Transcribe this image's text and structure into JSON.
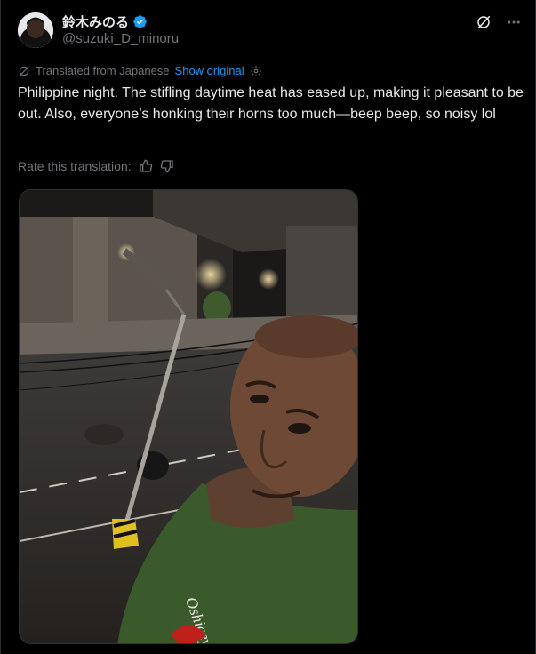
{
  "author": {
    "display_name": "鈴木みのる",
    "handle": "@suzuki_D_minoru"
  },
  "translation": {
    "label": "Translated from Japanese",
    "show_original": "Show original"
  },
  "post": {
    "text": "Philippine night. The stifling daytime heat has eased up, making it pleasant to be out. Also, everyone’s honking their horns too much—beep beep, so noisy lol"
  },
  "rate": {
    "label": "Rate this translation:"
  },
  "media": {
    "shirt_text": "Oshiceyo"
  },
  "colors": {
    "background": "#000000",
    "text": "#e7e9ea",
    "secondary": "#71767b",
    "accent": "#1d9bf0"
  },
  "icons": [
    "grok-icon",
    "more-icon",
    "translate-icon",
    "gear-icon",
    "thumbs-up-icon",
    "thumbs-down-icon",
    "verified-badge-icon"
  ]
}
